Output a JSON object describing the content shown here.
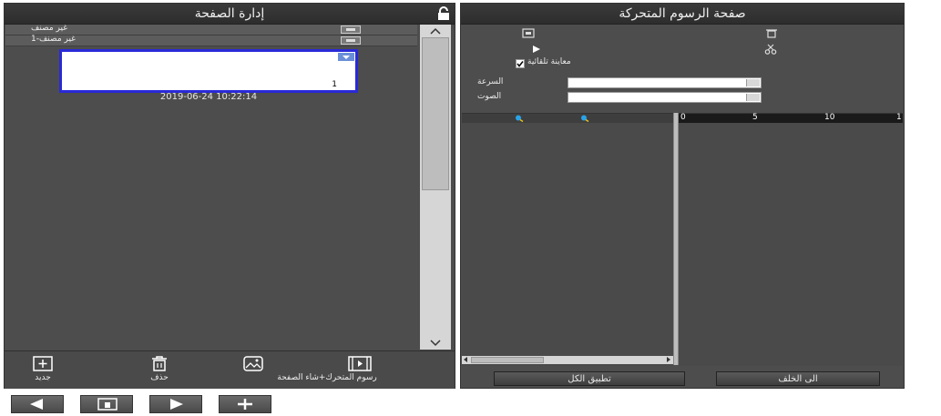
{
  "page_manager": {
    "title": "إدارة الصفحة",
    "groups": [
      {
        "label": "غير مصنف"
      },
      {
        "label": "غير مصنف-1"
      }
    ],
    "thumbnail": {
      "page_number": "1",
      "timestamp": "2019-06-24 10:22:14"
    },
    "toolbar": {
      "new_label": "جديد",
      "delete_label": "حذف",
      "animation_label": "رسوم المتحرك+شاء الصفحة"
    }
  },
  "animation_panel": {
    "title": "صفحة الرسوم المتحركة",
    "auto_preview_label": "معاينة تلقائية",
    "speed_label": "السرعة",
    "sound_label": "الصوت",
    "timeline_ticks": [
      "0",
      "5",
      "10",
      "1"
    ],
    "apply_all_label": "تطبيق الكل",
    "back_label": "الى الخلف"
  },
  "colors": {
    "panel_bg": "#4d4d4d",
    "titlebar_bg": "#2d2d2d",
    "thumbnail_border": "#2a2ad8"
  }
}
